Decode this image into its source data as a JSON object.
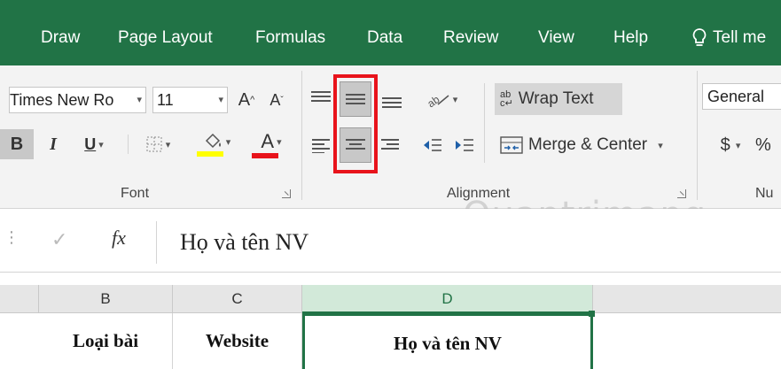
{
  "tabs": [
    "Draw",
    "Page Layout",
    "Formulas",
    "Data",
    "Review",
    "View",
    "Help"
  ],
  "tell_me": "Tell me",
  "font": {
    "name": "Times New Ro",
    "size": "11",
    "grow": "A",
    "shrink": "A",
    "bold": "B",
    "italic": "I",
    "underline": "U",
    "font_color_letter": "A",
    "group_label": "Font",
    "fill_color": "#ffff00",
    "font_color": "#e8131b"
  },
  "alignment": {
    "orientation_label": "ab",
    "wrap_text": "Wrap Text",
    "merge_center": "Merge & Center",
    "group_label": "Alignment"
  },
  "number": {
    "format": "General",
    "currency": "$",
    "percent": "%",
    "group_label": "Nu"
  },
  "formula_bar": {
    "fx": "fx",
    "value": "Họ và tên NV"
  },
  "columns": [
    "B",
    "C",
    "D"
  ],
  "row_cells": [
    "Loại bài",
    "Website",
    "Họ và tên NV"
  ],
  "watermark": "Quantrimang",
  "colors": {
    "accent": "#217346",
    "highlight": "#e8131b"
  }
}
